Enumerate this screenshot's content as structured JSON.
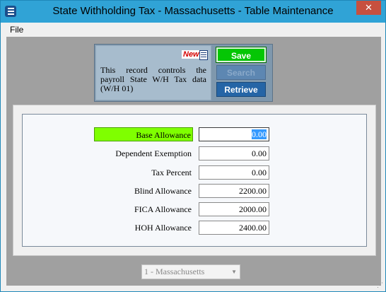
{
  "window": {
    "title": "State Withholding Tax - Massachusetts - Table Maintenance",
    "close_glyph": "✕"
  },
  "menu": {
    "file": "File"
  },
  "header": {
    "new_badge": "New!",
    "info": "This record controls the payroll State W/H Tax data (W/H 01)",
    "buttons": {
      "save": "Save",
      "search": "Search",
      "retrieve": "Retrieve"
    }
  },
  "fields": [
    {
      "label": "Base Allowance",
      "value": "0.00"
    },
    {
      "label": "Dependent Exemption",
      "value": "0.00"
    },
    {
      "label": "Tax Percent",
      "value": "0.00"
    },
    {
      "label": "Blind Allowance",
      "value": "2200.00"
    },
    {
      "label": "FICA Allowance",
      "value": "2000.00"
    },
    {
      "label": "HOH Allowance",
      "value": "2400.00"
    }
  ],
  "state_select": {
    "value": "1 - Massachusetts"
  },
  "colors": {
    "title_bar": "#30a3d6",
    "save": "#05c605",
    "highlight": "#7fff00",
    "retrieve": "#2565a6"
  }
}
